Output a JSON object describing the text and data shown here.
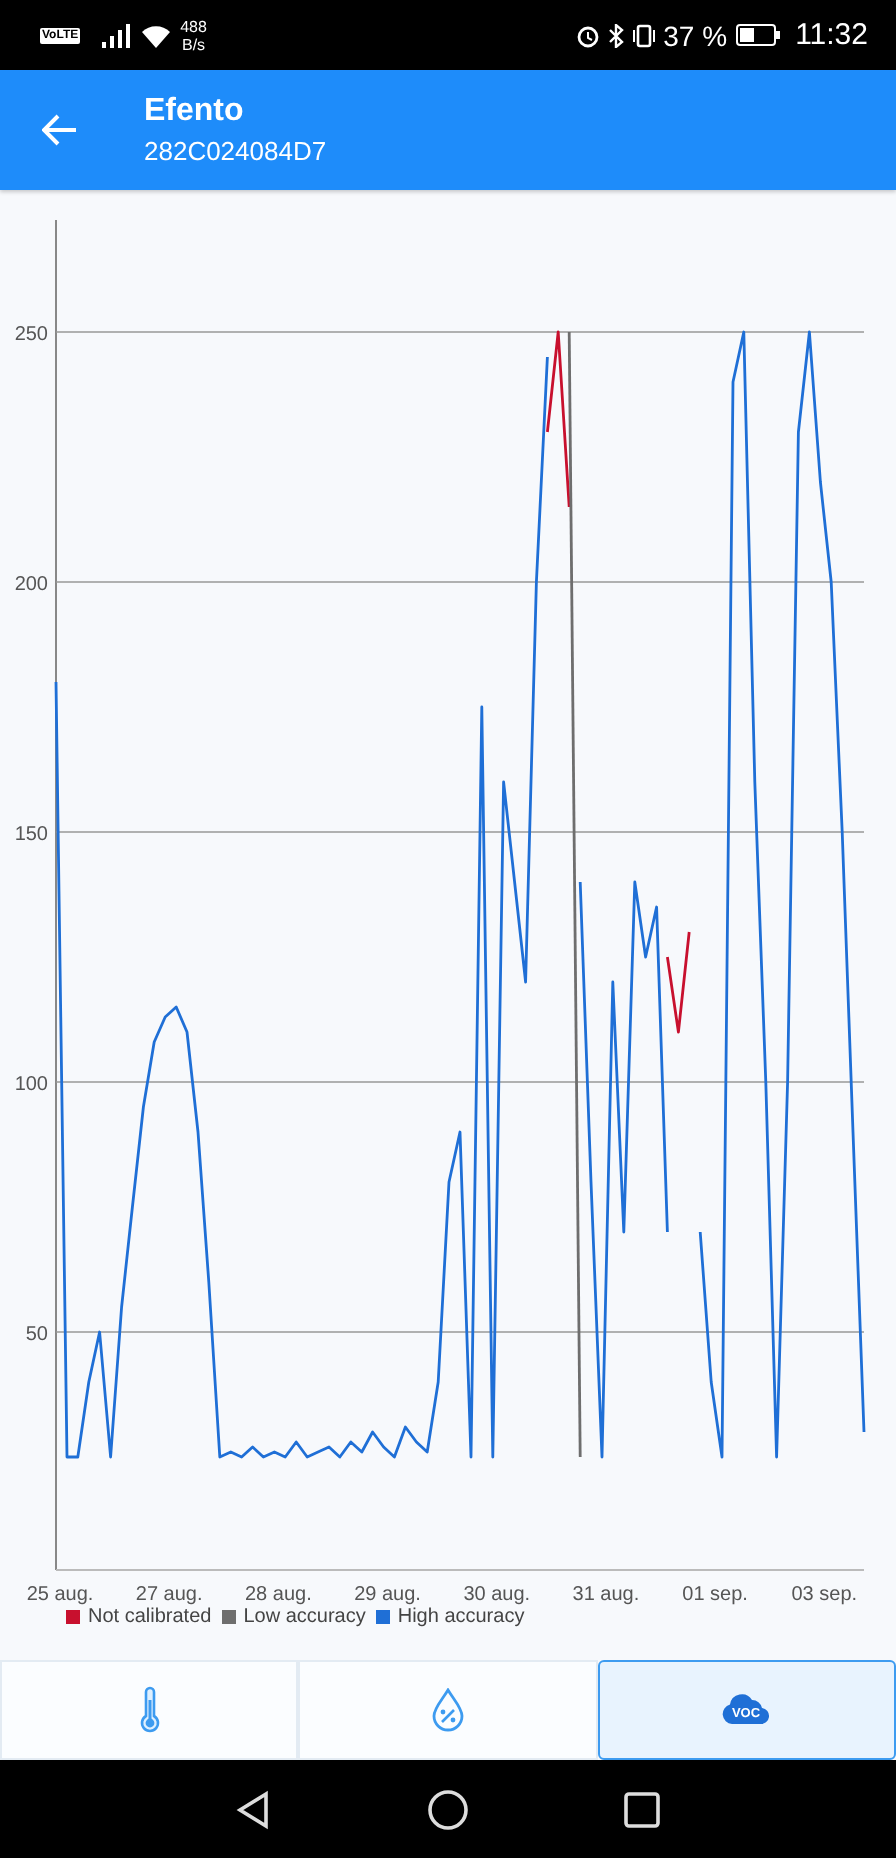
{
  "status_bar": {
    "network_badge": "VoLTE",
    "speed_value": "488",
    "speed_unit": "B/s",
    "battery_percent": "37 %",
    "time": "11:32"
  },
  "app_bar": {
    "title": "Efento",
    "subtitle": "282C024084D7"
  },
  "chart_data": {
    "type": "line",
    "grid": "y",
    "legend": "bottom",
    "ylim": [
      2.4,
      272.4
    ],
    "categories": [
      "25 aug.",
      null,
      null,
      null,
      null,
      null,
      null,
      null,
      null,
      null,
      "27 aug.",
      null,
      null,
      null,
      null,
      null,
      null,
      null,
      null,
      null,
      "28 aug.",
      null,
      null,
      null,
      null,
      null,
      null,
      null,
      null,
      null,
      "29 aug.",
      null,
      null,
      null,
      null,
      null,
      null,
      null,
      null,
      null,
      "30 aug.",
      null,
      null,
      null,
      null,
      null,
      null,
      null,
      null,
      null,
      "31 aug.",
      null,
      null,
      null,
      null,
      null,
      null,
      null,
      null,
      null,
      "01 sep.",
      null,
      null,
      null,
      null,
      null,
      null,
      null,
      null,
      null,
      "03 sep.",
      null,
      null,
      null,
      null
    ],
    "yticks": [
      50,
      100,
      150,
      200,
      250
    ],
    "series": [
      {
        "name": "Not calibrated",
        "color": "#c8102e",
        "values": [
          null,
          null,
          null,
          null,
          null,
          null,
          null,
          null,
          null,
          null,
          null,
          null,
          null,
          null,
          null,
          null,
          null,
          null,
          null,
          null,
          null,
          null,
          null,
          null,
          null,
          null,
          null,
          null,
          null,
          null,
          null,
          null,
          null,
          null,
          null,
          null,
          null,
          null,
          null,
          null,
          null,
          null,
          null,
          null,
          null,
          230,
          250,
          215,
          null,
          null,
          null,
          null,
          null,
          null,
          null,
          null,
          125,
          110,
          130,
          null,
          null,
          null,
          null,
          null,
          null,
          null,
          null,
          null,
          null,
          null,
          null,
          null,
          null,
          null,
          null
        ]
      },
      {
        "name": "Low accuracy",
        "color": "#6e6e6e",
        "values": [
          null,
          null,
          null,
          null,
          null,
          null,
          null,
          null,
          null,
          null,
          null,
          null,
          null,
          null,
          null,
          null,
          null,
          null,
          null,
          null,
          null,
          null,
          null,
          null,
          null,
          null,
          null,
          null,
          null,
          null,
          null,
          null,
          null,
          null,
          null,
          null,
          null,
          null,
          null,
          null,
          null,
          null,
          null,
          null,
          null,
          null,
          null,
          250,
          25,
          null,
          null,
          null,
          null,
          null,
          null,
          null,
          null,
          null,
          null,
          null,
          null,
          null,
          null,
          null,
          null,
          null,
          null,
          null,
          null,
          null,
          null,
          null,
          null,
          null,
          null
        ]
      },
      {
        "name": "High accuracy",
        "color": "#1f6fd6",
        "values": [
          180,
          25,
          25,
          40,
          50,
          25,
          55,
          75,
          95,
          108,
          113,
          115,
          110,
          90,
          60,
          25,
          26,
          25,
          27,
          25,
          26,
          25,
          28,
          25,
          26,
          27,
          25,
          28,
          26,
          30,
          27,
          25,
          31,
          28,
          26,
          40,
          80,
          90,
          25,
          175,
          25,
          160,
          140,
          120,
          200,
          245,
          null,
          null,
          140,
          80,
          25,
          120,
          70,
          140,
          125,
          135,
          70,
          null,
          null,
          70,
          40,
          25,
          240,
          250,
          160,
          100,
          25,
          100,
          230,
          250,
          220,
          200,
          150,
          90,
          30
        ]
      }
    ]
  },
  "tabs": [
    {
      "kind": "thermometer",
      "selected": false
    },
    {
      "kind": "humidity",
      "selected": false
    },
    {
      "kind": "voc",
      "label": "VOC",
      "selected": true
    }
  ]
}
